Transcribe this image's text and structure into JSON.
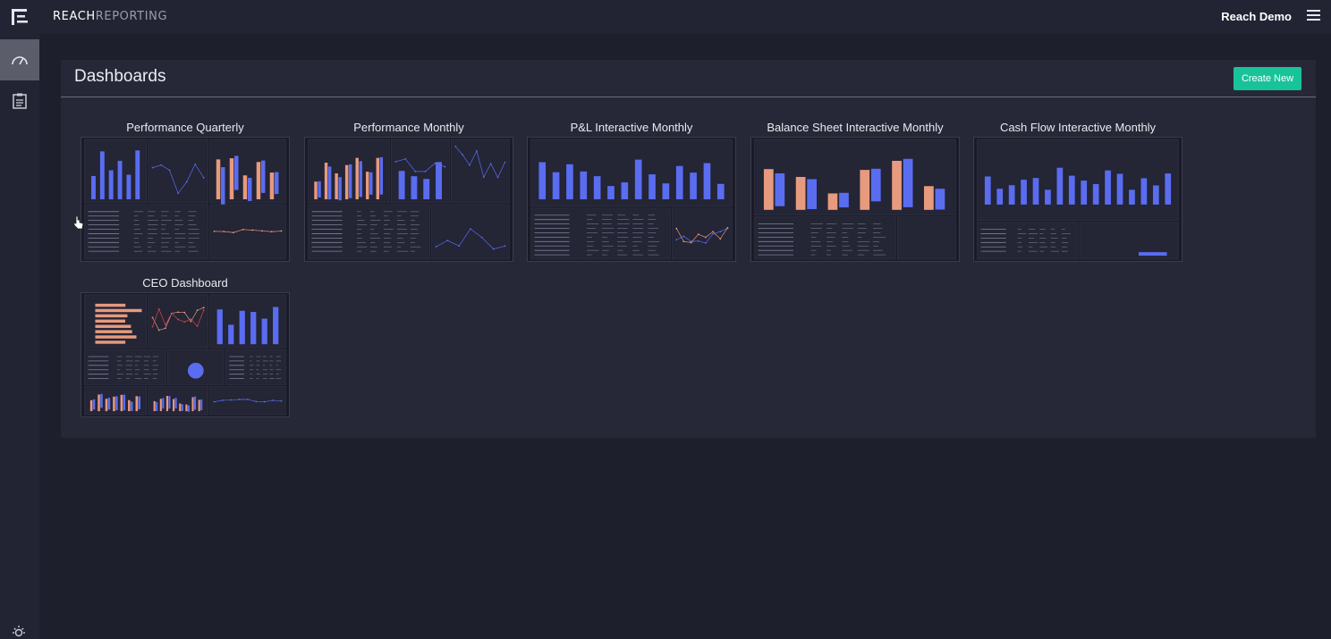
{
  "topbar": {
    "brand_bold": "REACH",
    "brand_light": "REPORTING",
    "username": "Reach Demo"
  },
  "sidebar": {
    "items": [
      {
        "name": "speedometer-icon",
        "active": true
      },
      {
        "name": "clipboard-icon",
        "active": false
      }
    ]
  },
  "panel": {
    "title": "Dashboards",
    "create_label": "Create New"
  },
  "dashboards": [
    {
      "title": "Performance Quarterly"
    },
    {
      "title": "Performance Monthly"
    },
    {
      "title": "P&L Interactive Monthly"
    },
    {
      "title": "Balance Sheet Interactive Monthly"
    },
    {
      "title": "Cash Flow Interactive Monthly"
    },
    {
      "title": "CEO Dashboard"
    }
  ],
  "colors": {
    "accent": "#19c39a",
    "background": "#1e1f2c",
    "panel": "#272837",
    "bar_blue": "#5a6cf0",
    "bar_orange": "#e79a7e"
  }
}
